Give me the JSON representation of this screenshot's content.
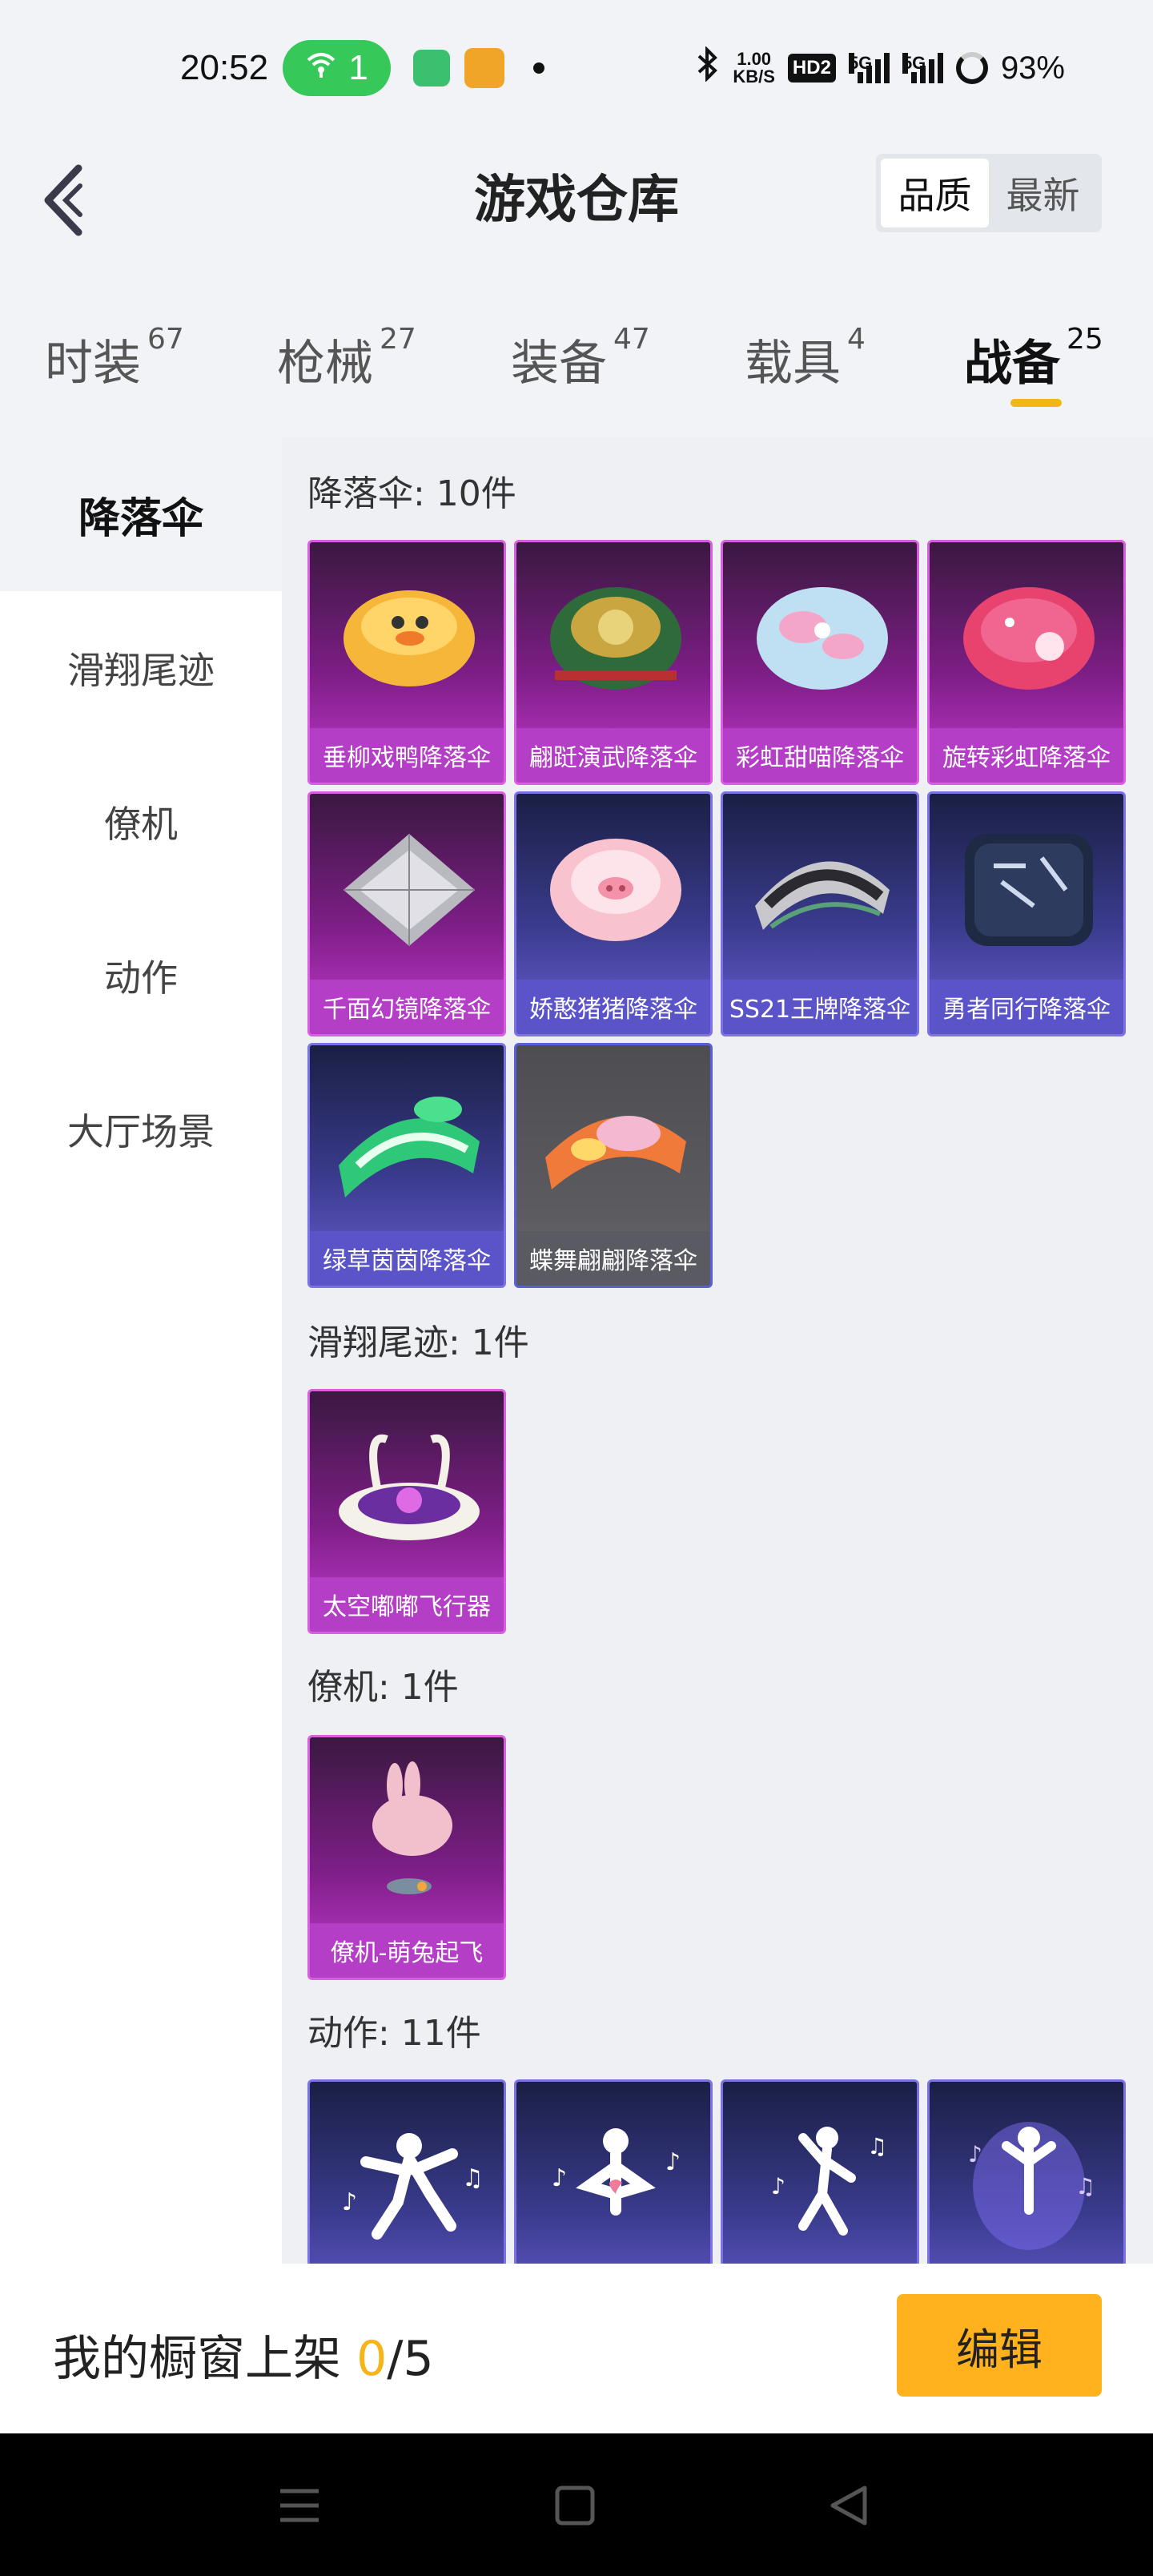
{
  "status_bar": {
    "time": "20:52",
    "hotspot_count": "1",
    "speed_value": "1.00",
    "speed_unit": "KB/S",
    "hd_label": "HD2",
    "signal_1": "5G",
    "signal_2": "5G",
    "battery": "93%"
  },
  "header": {
    "title": "游戏仓库",
    "sort_options": [
      "品质",
      "最新"
    ]
  },
  "tabs": [
    {
      "label": "时装",
      "count": "67"
    },
    {
      "label": "枪械",
      "count": "27"
    },
    {
      "label": "装备",
      "count": "47"
    },
    {
      "label": "载具",
      "count": "4"
    },
    {
      "label": "战备",
      "count": "25"
    }
  ],
  "sidebar": {
    "items": [
      "降落伞",
      "滑翔尾迹",
      "僚机",
      "动作",
      "大厅场景"
    ]
  },
  "sections": [
    {
      "title": "降落伞: 10件",
      "items": [
        {
          "name": "垂柳戏鸭降落伞",
          "rarity": "purple"
        },
        {
          "name": "翩跹演武降落伞",
          "rarity": "purple"
        },
        {
          "name": "彩虹甜喵降落伞",
          "rarity": "purple"
        },
        {
          "name": "旋转彩虹降落伞",
          "rarity": "purple"
        },
        {
          "name": "千面幻镜降落伞",
          "rarity": "purple"
        },
        {
          "name": "娇憨猪猪降落伞",
          "rarity": "blue"
        },
        {
          "name": "SS21王牌降落伞",
          "rarity": "blue"
        },
        {
          "name": "勇者同行降落伞",
          "rarity": "blue"
        },
        {
          "name": "绿草茵茵降落伞",
          "rarity": "blue"
        },
        {
          "name": "蝶舞翩翩降落伞",
          "rarity": "gray"
        }
      ]
    },
    {
      "title": "滑翔尾迹: 1件",
      "items": [
        {
          "name": "太空嘟嘟飞行器",
          "rarity": "purple"
        }
      ]
    },
    {
      "title": "僚机: 1件",
      "items": [
        {
          "name": "僚机-萌兔起飞",
          "rarity": "purple"
        }
      ]
    },
    {
      "title": "动作: 11件",
      "items": [
        {
          "name": "",
          "rarity": "blue"
        },
        {
          "name": "",
          "rarity": "blue"
        },
        {
          "name": "",
          "rarity": "blue"
        },
        {
          "name": "",
          "rarity": "blue"
        }
      ]
    }
  ],
  "bottom_bar": {
    "showcase_label": "我的橱窗上架",
    "showcase_current": "0",
    "showcase_total": "/5",
    "edit_button": "编辑"
  },
  "colors": {
    "accent": "#f5b417",
    "rarity_purple": "#c53ad0",
    "rarity_blue": "#6a5fd6",
    "rarity_gray": "#5a5a62"
  }
}
